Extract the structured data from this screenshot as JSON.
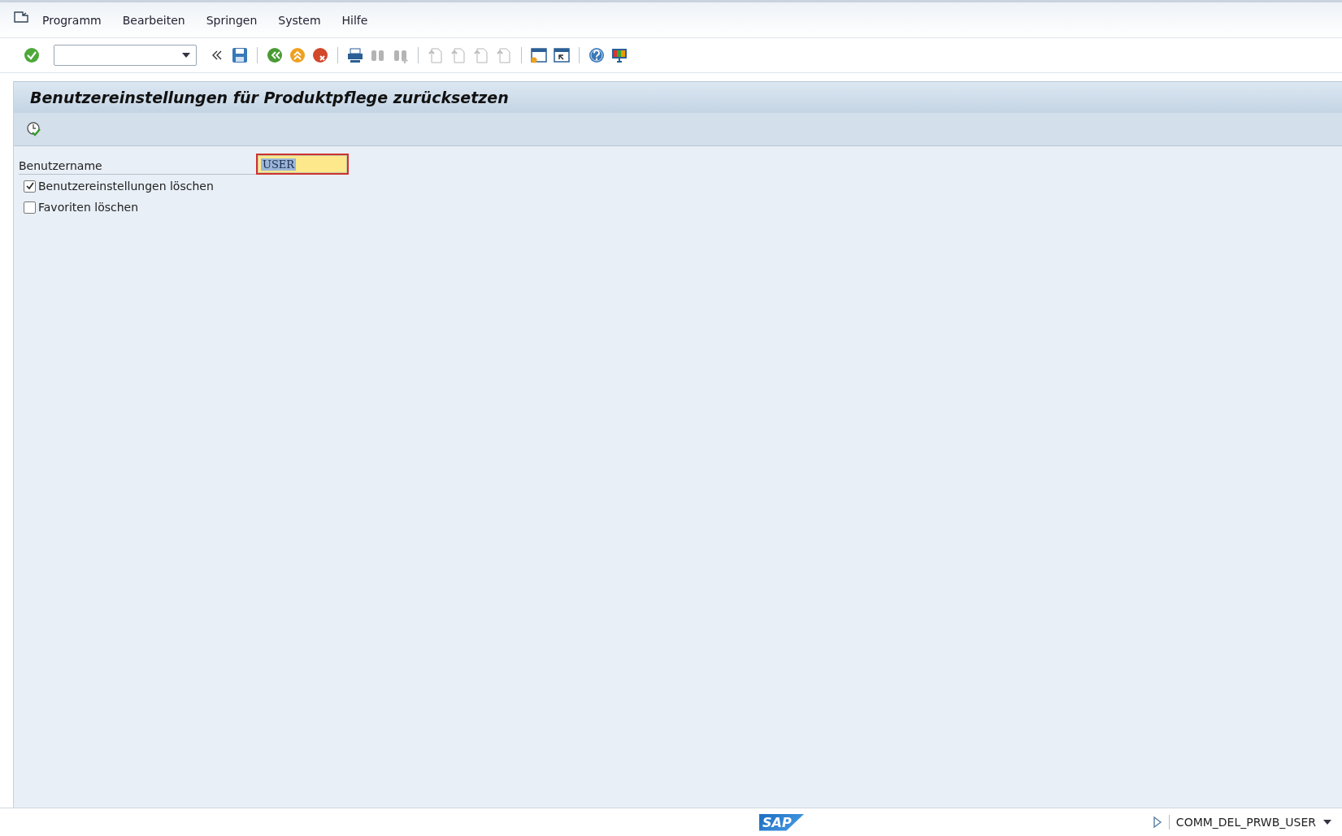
{
  "menu": [
    "Programm",
    "Bearbeiten",
    "Springen",
    "System",
    "Hilfe"
  ],
  "toolbar": [
    {
      "kind": "check",
      "disabled": false
    },
    {
      "kind": "combo"
    },
    {
      "kind": "back-chevron",
      "disabled": false
    },
    {
      "kind": "save",
      "disabled": false
    },
    {
      "kind": "sep"
    },
    {
      "kind": "back",
      "disabled": false
    },
    {
      "kind": "up",
      "disabled": false
    },
    {
      "kind": "cancel",
      "disabled": false
    },
    {
      "kind": "sep"
    },
    {
      "kind": "print",
      "disabled": false
    },
    {
      "kind": "find",
      "disabled": true
    },
    {
      "kind": "find-next",
      "disabled": true
    },
    {
      "kind": "sep"
    },
    {
      "kind": "page",
      "disabled": true
    },
    {
      "kind": "page",
      "disabled": true
    },
    {
      "kind": "page",
      "disabled": true
    },
    {
      "kind": "page",
      "disabled": true
    },
    {
      "kind": "sep"
    },
    {
      "kind": "window-new",
      "disabled": false
    },
    {
      "kind": "window-link",
      "disabled": false
    },
    {
      "kind": "sep"
    },
    {
      "kind": "help",
      "disabled": false
    },
    {
      "kind": "monitor",
      "disabled": false
    }
  ],
  "title": "Benutzereinstellungen für Produktpflege zurücksetzen",
  "form": {
    "label": "Benutzername",
    "value": "USER"
  },
  "options": [
    {
      "label": "Benutzereinstellungen löschen",
      "checked": true
    },
    {
      "label": "Favoriten löschen",
      "checked": false
    }
  ],
  "status_bar": {
    "logo": "SAP",
    "transaction": "COMM_DEL_PRWB_USER"
  }
}
